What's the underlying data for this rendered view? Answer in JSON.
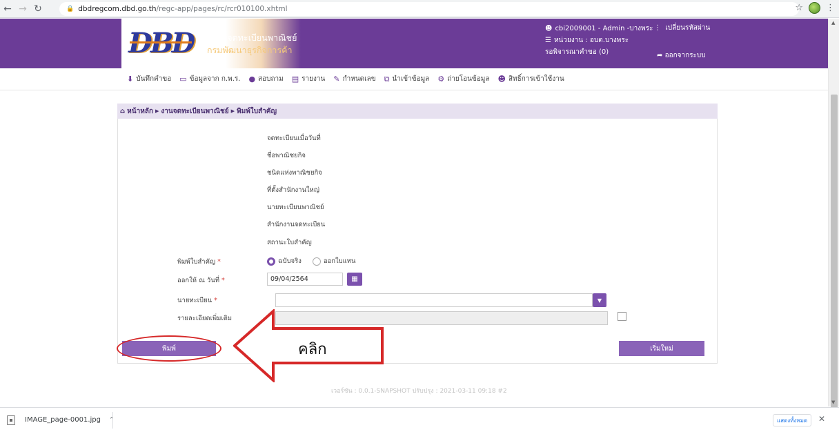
{
  "browser": {
    "url_domain": "dbdregcom.dbd.go.th",
    "url_path": "/regc-app/pages/rc/rcr010100.xhtml"
  },
  "header": {
    "logo_text": "DBD",
    "system_name": "ระบบจดทะเบียนพาณิชย์",
    "department": "กรมพัฒนาธุรกิจการค้า",
    "user": "cbi2009001 - Admin -บางพระ",
    "unit": "หน่วยงาน : อบต.บางพระ",
    "pending": "รอพิจารณาคำขอ (0)",
    "change_password": "เปลี่ยนรหัสผ่าน",
    "logout": "ออกจากระบบ"
  },
  "menu": [
    {
      "label": "บันทึกคำขอ",
      "icon": "download-icon"
    },
    {
      "label": "ข้อมูลจาก ก.พ.ร.",
      "icon": "monitor-icon"
    },
    {
      "label": "สอบถาม",
      "icon": "chat-icon"
    },
    {
      "label": "รายงาน",
      "icon": "report-icon"
    },
    {
      "label": "กำหนดเลข",
      "icon": "edit-icon"
    },
    {
      "label": "นำเข้าข้อมูล",
      "icon": "import-icon"
    },
    {
      "label": "ถ่ายโอนข้อมูล",
      "icon": "gear-icon"
    },
    {
      "label": "สิทธิ์การเข้าใช้งาน",
      "icon": "user-icon"
    }
  ],
  "breadcrumb": {
    "home": "หน้าหลัก",
    "section": "งานจดทะเบียนพาณิชย์",
    "page": "พิมพ์ใบสำคัญ"
  },
  "info_labels": [
    "จดทะเบียนเมื่อวันที่",
    "ชื่อพาณิชยกิจ",
    "ชนิดแห่งพาณิชยกิจ",
    "ที่ตั้งสำนักงานใหญ่",
    "นายทะเบียนพาณิชย์",
    "สำนักงานจดทะเบียน",
    "สถานะใบสำคัญ"
  ],
  "form": {
    "print_type_label": "พิมพ์ใบสำคัญ",
    "radio_original": "ฉบับจริง",
    "radio_replacement": "ออกใบแทน",
    "issue_date_label": "ออกให้ ณ วันที่",
    "issue_date_value": "09/04/2564",
    "registrar_label": "นายทะเบียน",
    "details_label": "รายละเอียดเพิ่มเติม",
    "required_mark": "*",
    "print_button": "พิมพ์",
    "reset_button": "เริ่มใหม่"
  },
  "footer": {
    "version": "เวอร์ชัน : 0.0.1-SNAPSHOT ปรับปรุง : 2021-03-11 09:18 #2"
  },
  "annotation": {
    "label": "คลิก",
    "color": "#d62828"
  },
  "download_bar": {
    "filename": "IMAGE_page-0001.jpg",
    "show_all": "แสดงทั้งหมด"
  },
  "colors": {
    "header_purple": "#6b3c97",
    "button_purple": "#8a63b8",
    "annotation_red": "#d62828"
  }
}
